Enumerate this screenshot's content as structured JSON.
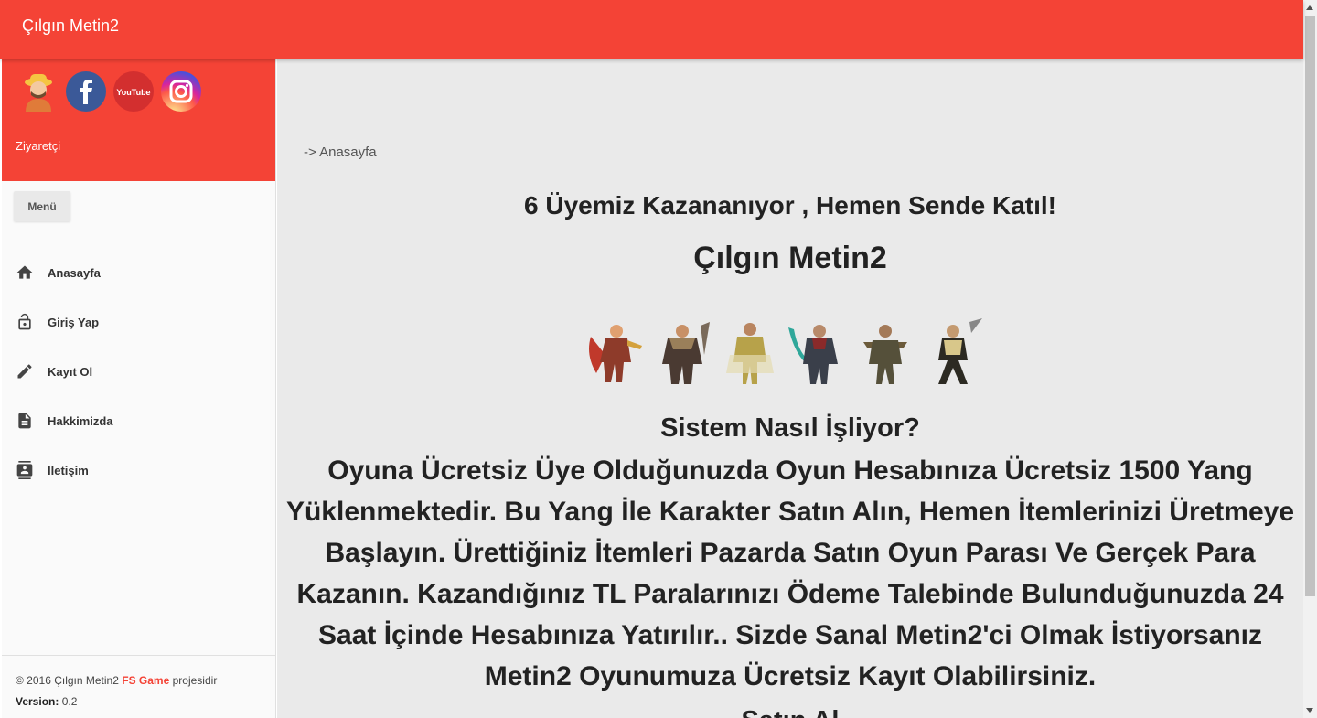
{
  "header": {
    "title": "Çılgın Metin2"
  },
  "sidebar": {
    "social_icons": [
      "user-avatar-icon",
      "facebook-icon",
      "youtube-icon",
      "instagram-icon"
    ],
    "youtube_text": "YouTube",
    "visitor_label": "Ziyaretçi",
    "menu_button": "Menü",
    "items": [
      {
        "label": "Anasayfa",
        "icon": "home-icon"
      },
      {
        "label": "Giriş Yap",
        "icon": "lock-icon"
      },
      {
        "label": "Kayıt Ol",
        "icon": "pencil-icon"
      },
      {
        "label": "Hakkimizda",
        "icon": "document-icon"
      },
      {
        "label": "Iletişim",
        "icon": "contact-icon"
      }
    ],
    "footer": {
      "copyright": "© 2016 Çılgın Metin2",
      "brand": "FS Game",
      "suffix": "projesidir",
      "version_label": "Version:",
      "version_value": "0.2"
    }
  },
  "main": {
    "breadcrumb": "-> Anasayfa",
    "headline": "6 Üyemiz Kazananıyor , Hemen Sende Katıl!",
    "site_title": "Çılgın Metin2",
    "section_title": "Sistem Nasıl İşliyor?",
    "description": "Oyuna Ücretsiz Üye Olduğunuzda Oyun Hesabınıza Ücretsiz 1500 Yang Yüklenmektedir. Bu Yang İle Karakter Satın Alın, Hemen İtemlerinizi Üretmeye Başlayın. Ürettiğiniz İtemleri Pazarda Satın Oyun Parası Ve Gerçek Para Kazanın. Kazandığınız TL Paralarınızı Ödeme Talebinde Bulunduğunuzda 24 Saat İçinde Hesabınıza Yatırılır.. Sizde Sanal Metin2'ci Olmak İstiyorsanız Metin2 Oyunumuza Ücretsiz Kayıt Olabilirsiniz.",
    "cut_off_heading": "Satın Al"
  },
  "colors": {
    "primary": "#f44336",
    "main_bg": "#eaeaea",
    "sidebar_bg": "#fafafa"
  }
}
